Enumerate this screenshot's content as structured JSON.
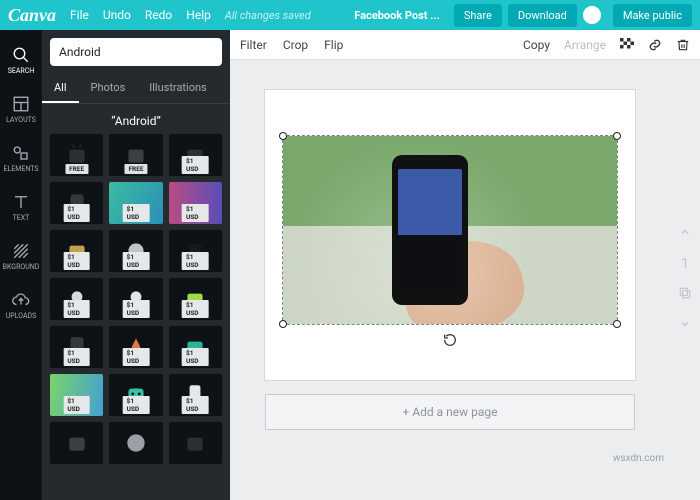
{
  "brand": "Canva",
  "menu": {
    "file": "File",
    "undo": "Undo",
    "redo": "Redo",
    "help": "Help"
  },
  "status_saved": "All changes saved",
  "doc_title": "Facebook Post ...",
  "actions": {
    "share": "Share",
    "download": "Download",
    "make_public": "Make public"
  },
  "rail": {
    "search": "SEARCH",
    "layouts": "LAYOUTS",
    "elements": "ELEMENTS",
    "text": "TEXT",
    "bkground": "BKGROUND",
    "uploads": "UPLOADS"
  },
  "search": {
    "value": "Android"
  },
  "panel_tabs": {
    "all": "All",
    "photos": "Photos",
    "illustrations": "Illustrations"
  },
  "results_title": "“Android”",
  "prices": {
    "free": "FREE",
    "one_usd": "$1 USD"
  },
  "toolbar": {
    "filter": "Filter",
    "crop": "Crop",
    "flip": "Flip",
    "copy": "Copy",
    "arrange": "Arrange"
  },
  "add_page": "+ Add a new page",
  "page_nav": {
    "current": "1"
  },
  "watermark": "wsxdn.com"
}
